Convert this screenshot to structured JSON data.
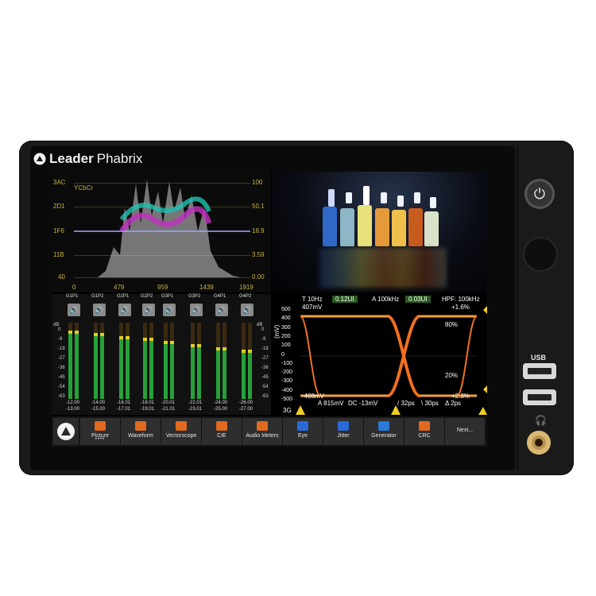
{
  "device": {
    "brand_bold": "Leader",
    "brand_light": "Phabrix"
  },
  "waveform": {
    "color_space": "YCbCr",
    "left_ticks": [
      "3AC",
      "2D1",
      "1F6",
      "11B",
      "40"
    ],
    "right_ticks": [
      "100",
      "50.1",
      "18.9",
      "3.59",
      "0.00"
    ],
    "x_ticks": [
      "0",
      "479",
      "959",
      "1439",
      "1919"
    ]
  },
  "audio": {
    "channels": [
      {
        "name": "G1P1",
        "v1": "-12.00",
        "v2": "-13.00",
        "level": 0.88
      },
      {
        "name": "G1P2",
        "v1": "-14.00",
        "v2": "-15.00",
        "level": 0.84
      },
      {
        "name": "G2P1",
        "v1": "-16.01",
        "v2": "-17.01",
        "level": 0.8
      },
      {
        "name": "G2P2",
        "v1": "-18.01",
        "v2": "-19.01",
        "level": 0.78
      },
      {
        "name": "G3P1",
        "v1": "-20.01",
        "v2": "-21.01",
        "level": 0.74
      },
      {
        "name": "G3P2",
        "v1": "-22.01",
        "v2": "-23.01",
        "level": 0.7
      },
      {
        "name": "G4P1",
        "v1": "-24.00",
        "v2": "-25.00",
        "level": 0.66
      },
      {
        "name": "G4P2",
        "v1": "-26.00",
        "v2": "-27.00",
        "level": 0.62
      }
    ],
    "unit": "dB",
    "scale": [
      "0",
      "-9",
      "-18",
      "-27",
      "-36",
      "-45",
      "-54",
      "-63"
    ]
  },
  "eye": {
    "t_label": "T 10Hz",
    "t_val": "0.12UI",
    "a_label": "A 100kHz",
    "a_val": "0.03UI",
    "hpf": "HPF: 100kHz",
    "top_mv": "407mV",
    "bottom_mv": "-408mV",
    "top_pct": "+1.6%",
    "bottom_pct": "+2.3%",
    "pct80": "80%",
    "pct20": "20%",
    "y_unit": "(mV)",
    "y_ticks": [
      "500",
      "400",
      "300",
      "200",
      "100",
      "0",
      "-100",
      "-200",
      "-300",
      "-400",
      "-500"
    ],
    "rate": "3G",
    "amp": "A 815mV",
    "dc": "DC -13mV",
    "rise": "/ 32ps",
    "fall": "\\ 30ps",
    "delta": "Δ 2ps"
  },
  "toolbar": {
    "buttons": [
      {
        "label": "Picture",
        "color": "#e06a20",
        "active": true
      },
      {
        "label": "Waveform",
        "color": "#e06a20"
      },
      {
        "label": "Vectorscope",
        "color": "#e06a20"
      },
      {
        "label": "CIE",
        "color": "#e06a20"
      },
      {
        "label": "Audio Meters",
        "color": "#e06a20"
      },
      {
        "label": "Eye",
        "color": "#2a6ad8"
      },
      {
        "label": "Jitter",
        "color": "#2a6ad8"
      },
      {
        "label": "Generator",
        "color": "#2a7ad8"
      },
      {
        "label": "CRC",
        "color": "#e06a20"
      },
      {
        "label": "Next...",
        "color": ""
      }
    ],
    "dots": "••••"
  },
  "right_panel": {
    "usb_label": "USB"
  }
}
